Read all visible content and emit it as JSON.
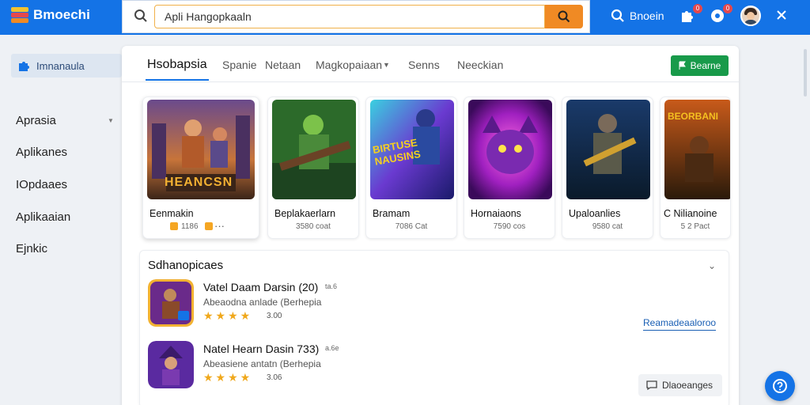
{
  "app": {
    "name": "Bmoechi"
  },
  "search": {
    "value": "Apli Hangopkaaln"
  },
  "header": {
    "search_label": "Bnoein",
    "notif_count": "0",
    "alert_count": "0"
  },
  "sidebar": {
    "active": "Imnanaula",
    "items": [
      {
        "label": "Aprasia"
      },
      {
        "label": "Aplikanes"
      },
      {
        "label": "IOpdaaes"
      },
      {
        "label": "Aplikaaian"
      },
      {
        "label": "Ejnkic"
      }
    ]
  },
  "tabs": [
    {
      "label": "Hsobapsia"
    },
    {
      "label": "Spanie"
    },
    {
      "label": "Netaan"
    },
    {
      "label": "Magkopaiaan"
    },
    {
      "label": "Senns"
    },
    {
      "label": "Neeckian"
    }
  ],
  "action_button": {
    "label": "Bearne"
  },
  "cards": [
    {
      "title": "Eenmakin",
      "sub": "1186",
      "more": "···",
      "art_text": "HEANCSN"
    },
    {
      "title": "Beplakaerlarn",
      "sub": "3580 coat",
      "art_text": ""
    },
    {
      "title": "Bramam",
      "sub": "7086 Cat",
      "art_text": "BIRTUSE NAUSINS"
    },
    {
      "title": "Hornaiaons",
      "sub": "7590 cos",
      "art_text": ""
    },
    {
      "title": "Upaloanlies",
      "sub": "9580 cat",
      "art_text": ""
    },
    {
      "title": "C Nilianoine",
      "sub": "5 2 Pact",
      "art_text": "BEORBANI"
    }
  ],
  "section": {
    "title": "Sdhanopicaes",
    "link": "Reamadeaaloroo",
    "message_button": "Dlaoeanges",
    "rows": [
      {
        "title": "Vatel Daam Darsin (20)",
        "tag": "ta.6",
        "desc": "Abeaodna anlade (Berhepia",
        "stars": "★★★★",
        "rating": "3.00"
      },
      {
        "title": "Natel Hearn Dasin 733)",
        "tag": "a.6e",
        "desc": "Abeasiene antatn (Berhepia",
        "stars": "★★★★",
        "rating": "3.06"
      }
    ]
  },
  "colors": {
    "primary": "#1473e6",
    "search_button": "#f08a24",
    "green": "#189a4a",
    "star": "#f0a81c"
  }
}
